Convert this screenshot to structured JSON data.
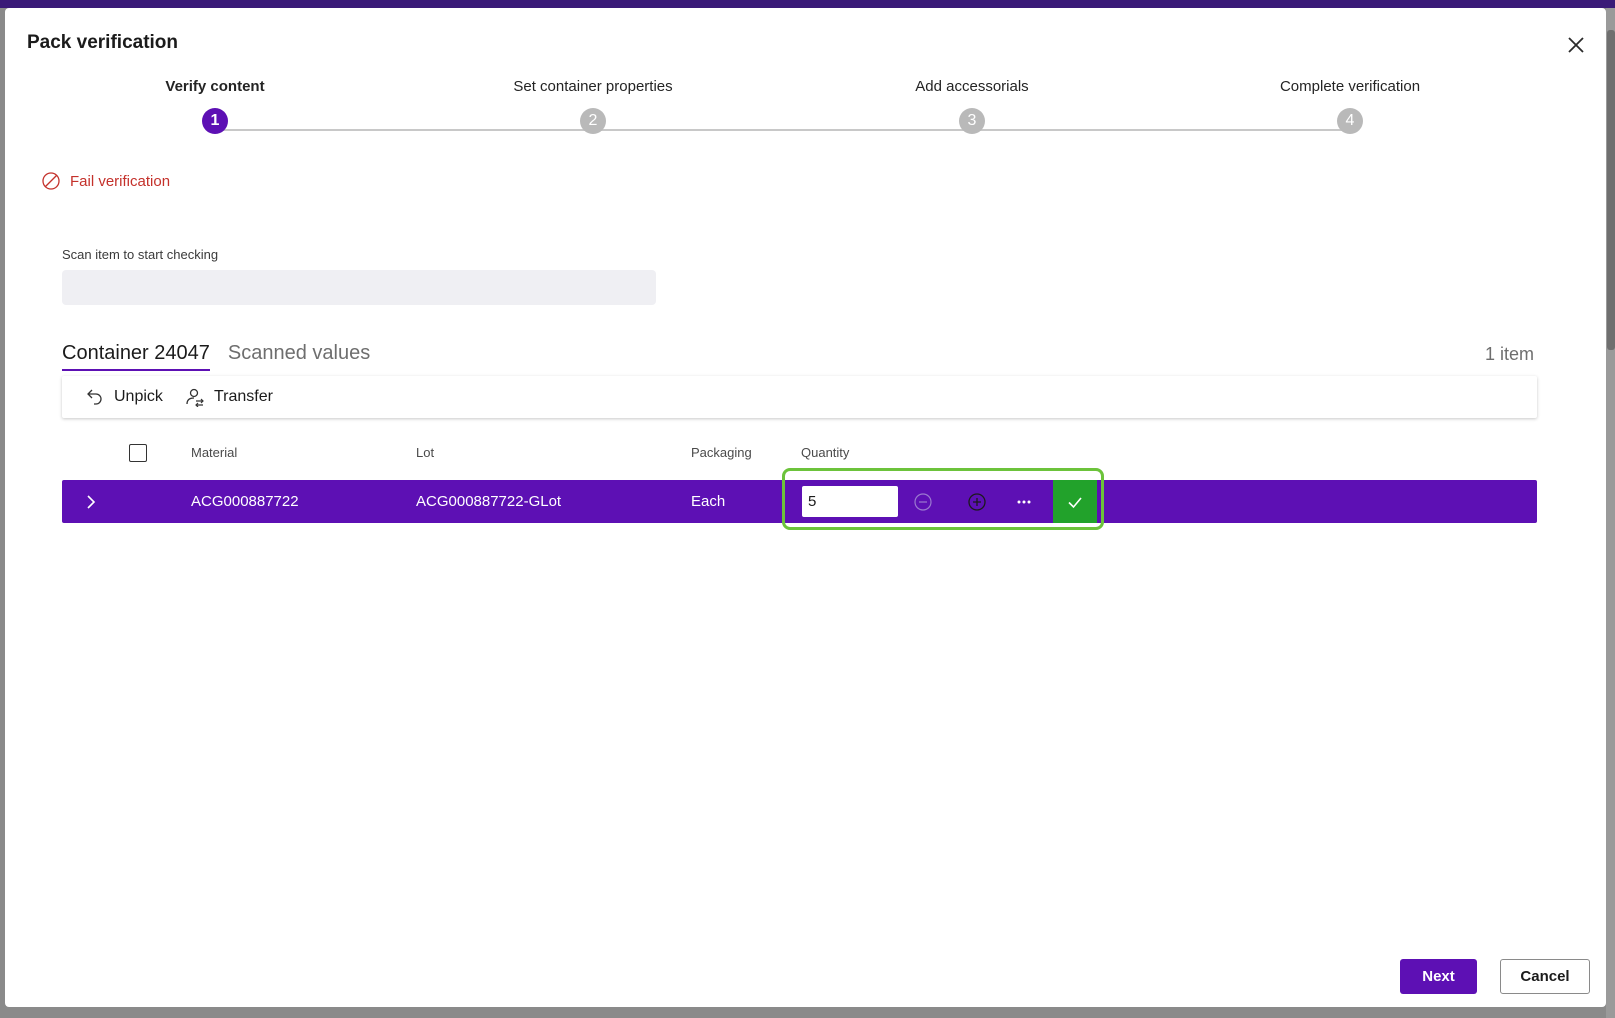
{
  "dialog": {
    "title": "Pack verification"
  },
  "steps": [
    {
      "number": "1",
      "label": "Verify content"
    },
    {
      "number": "2",
      "label": "Set container properties"
    },
    {
      "number": "3",
      "label": "Add accessorials"
    },
    {
      "number": "4",
      "label": "Complete verification"
    }
  ],
  "active_step": 1,
  "fail_verification": {
    "label": "Fail verification"
  },
  "scan": {
    "label": "Scan item to start checking",
    "value": ""
  },
  "tabs": [
    {
      "label": "Container 24047"
    },
    {
      "label": "Scanned values"
    }
  ],
  "item_count": "1 item",
  "toolbar": {
    "unpick_label": "Unpick",
    "transfer_label": "Transfer"
  },
  "table": {
    "columns": {
      "material": "Material",
      "lot": "Lot",
      "packaging": "Packaging",
      "quantity": "Quantity"
    },
    "rows": [
      {
        "material": "ACG000887722",
        "lot": "ACG000887722-GLot",
        "packaging": "Each",
        "quantity": "5"
      }
    ]
  },
  "footer": {
    "next_label": "Next",
    "cancel_label": "Cancel"
  },
  "colors": {
    "accent": "#5d10b4",
    "confirm": "#22a22b",
    "highlight": "#6cc33b",
    "error": "#c4312b"
  }
}
